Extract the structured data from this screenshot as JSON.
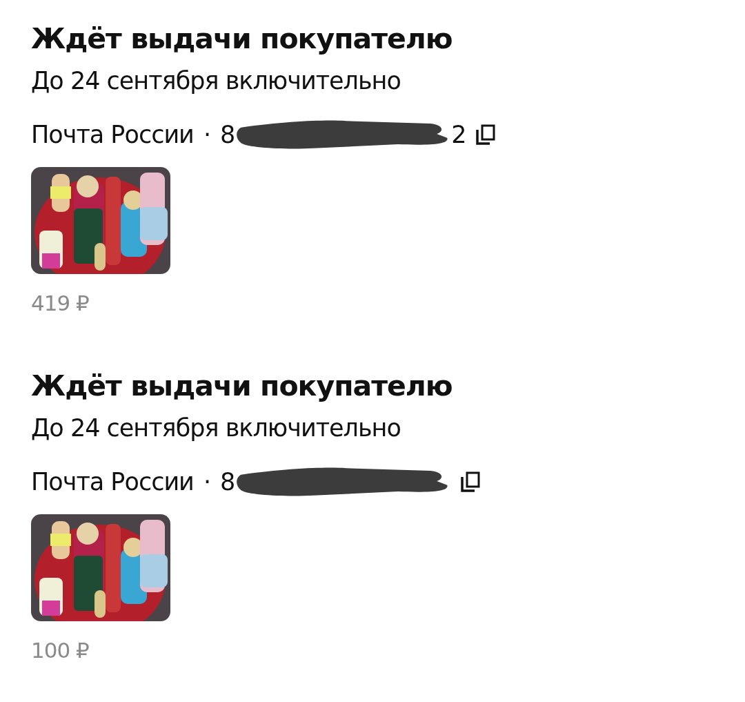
{
  "orders": [
    {
      "status": "Ждёт выдачи покупателю",
      "deadline": "До 24 сентября включительно",
      "carrier": "Почта России",
      "separator": "·",
      "tracking_start": "8",
      "tracking_end": "2",
      "redacted": true,
      "price": "419 ₽"
    },
    {
      "status": "Ждёт выдачи покупателю",
      "deadline": "До 24 сентября включительно",
      "carrier": "Почта России",
      "separator": "·",
      "tracking_start": "8",
      "redacted": true,
      "price": "100 ₽"
    }
  ]
}
